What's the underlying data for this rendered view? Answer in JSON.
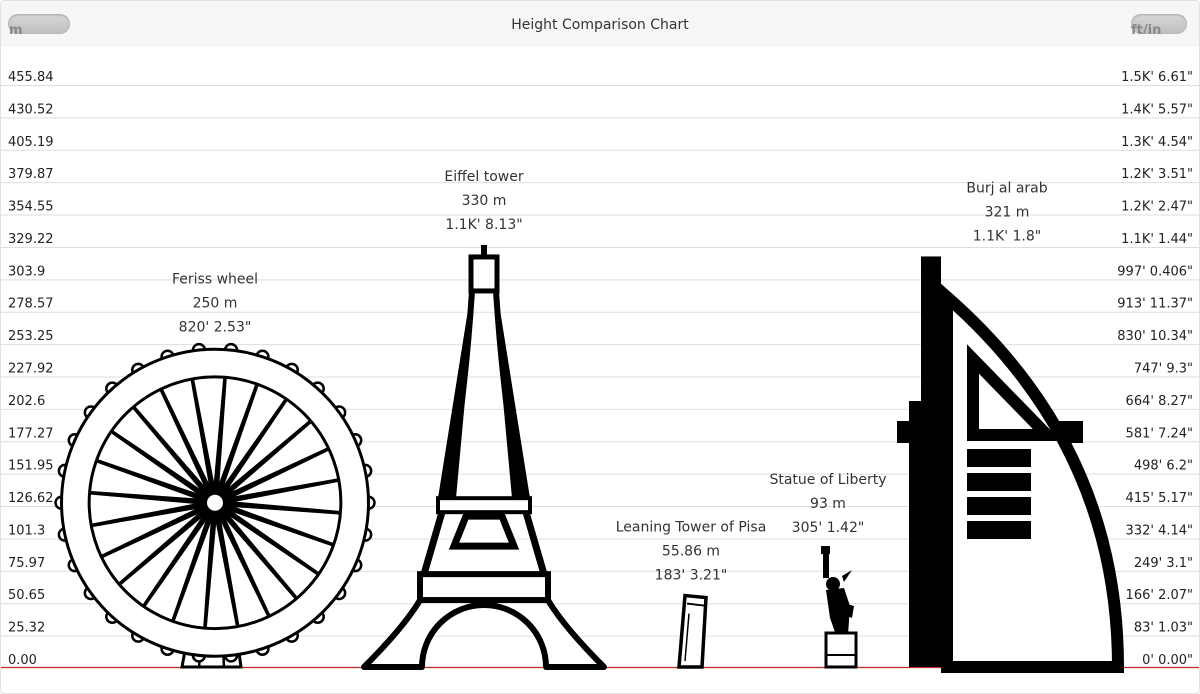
{
  "window": {
    "title": "Height Comparison Chart",
    "left_unit": "m",
    "right_unit": "ft/in"
  },
  "chart_data": {
    "type": "bar",
    "title": "Height Comparison Chart",
    "ylim": [
      0,
      455.84
    ],
    "grid": true,
    "y_ticks_m": [
      "0.00",
      "25.32",
      "50.65",
      "75.97",
      "101.3",
      "126.62",
      "151.95",
      "177.27",
      "202.6",
      "227.92",
      "253.25",
      "278.57",
      "303.9",
      "329.22",
      "354.55",
      "379.87",
      "405.19",
      "430.52",
      "455.84"
    ],
    "y_ticks_ft": [
      "0' 0.00\"",
      "83' 1.03\"",
      "166' 2.07\"",
      "249' 3.1\"",
      "332' 4.14\"",
      "415' 5.17\"",
      "498' 6.2\"",
      "581' 7.24\"",
      "664' 8.27\"",
      "747' 9.3\"",
      "830' 10.34\"",
      "913' 11.37\"",
      "997' 0.406\"",
      "1.1K' 1.44\"",
      "1.2K' 2.47\"",
      "1.2K' 3.51\"",
      "1.3K' 4.54\"",
      "1.4K' 5.57\"",
      "1.5K' 6.61\""
    ],
    "items": [
      {
        "name": "Feriss wheel",
        "height_m": 250,
        "m_label": "250 m",
        "ft_label": "820' 2.53\"",
        "icon": "ferris-wheel-icon"
      },
      {
        "name": "Eiffel tower",
        "height_m": 330,
        "m_label": "330 m",
        "ft_label": "1.1K' 8.13\"",
        "icon": "eiffel-tower-icon"
      },
      {
        "name": "Leaning Tower of Pisa",
        "height_m": 55.86,
        "m_label": "55.86 m",
        "ft_label": "183' 3.21\"",
        "icon": "pisa-tower-icon"
      },
      {
        "name": "Statue of Liberty",
        "height_m": 93,
        "m_label": "93 m",
        "ft_label": "305' 1.42\"",
        "icon": "statue-of-liberty-icon"
      },
      {
        "name": "Burj al arab",
        "height_m": 321,
        "m_label": "321 m",
        "ft_label": "1.1K' 1.8\"",
        "icon": "burj-al-arab-icon"
      }
    ]
  }
}
